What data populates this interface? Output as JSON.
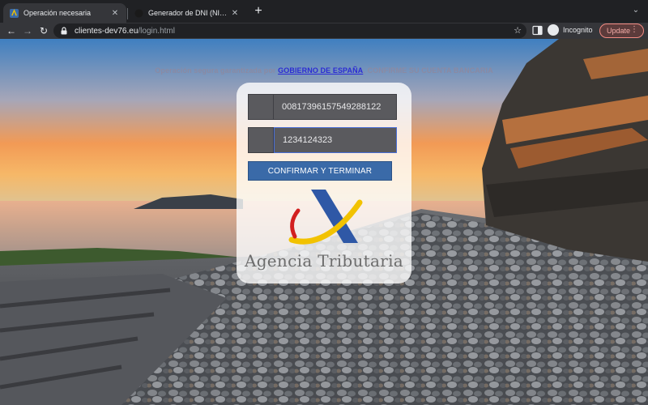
{
  "browser": {
    "tabs": [
      {
        "title": "Operación necesaria",
        "active": true
      },
      {
        "title": "Generador de DNI (NIF, NIE, CIF)",
        "active": false
      }
    ],
    "url_host": "clientes-dev76.eu",
    "url_path": "/login.html",
    "incognito_label": "Incognito",
    "update_label": "Update"
  },
  "page": {
    "banner_before": "Operación segura garantizada por ",
    "banner_link": "GOBIERNO DE ESPAÑA",
    "banner_after": ". CONFIRME SU CUENTA BANCARIA",
    "field1_value": "00817396157549288122",
    "field2_value": "1234124323",
    "confirm_label": "CONFIRMAR Y TERMINAR",
    "agency_name": "Agencia Tributaria"
  },
  "colors": {
    "confirm_button": "#3a6aa8",
    "logo_blue": "#2f58a6",
    "logo_yellow": "#f2c200",
    "logo_red": "#d21f1f"
  }
}
